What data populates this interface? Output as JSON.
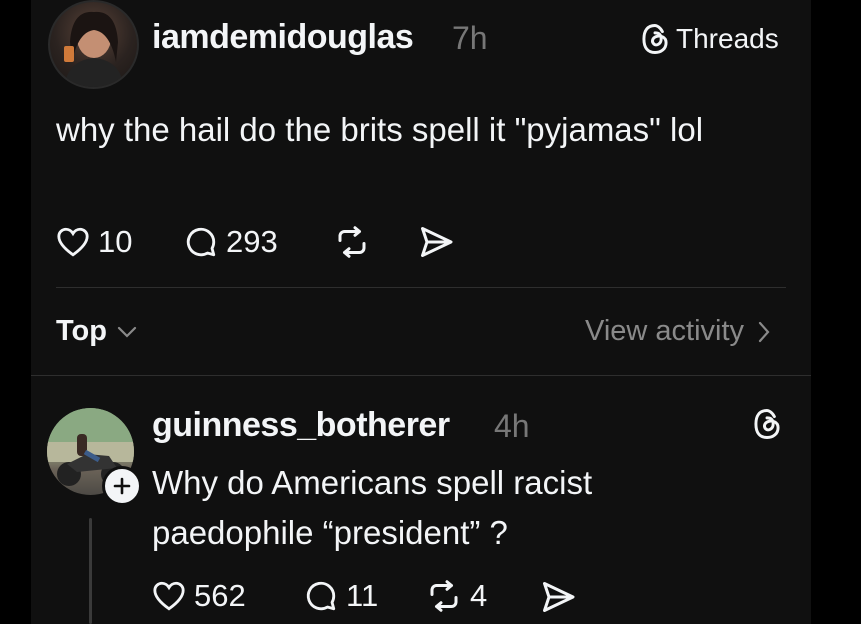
{
  "post": {
    "username": "iamdemidouglas",
    "time": "7h",
    "brand": "Threads",
    "text": "why the hail do the brits spell it \"pyjamas\" lol",
    "likes": "10",
    "replies": "293"
  },
  "sort": {
    "label": "Top",
    "view_activity": "View activity"
  },
  "reply": {
    "username": "guinness_botherer",
    "time": "4h",
    "text": "Why do Americans spell racist paedophile “president” ?",
    "likes": "562",
    "replies": "11",
    "reposts": "4"
  },
  "icons": [
    "heart-icon",
    "comment-icon",
    "repost-icon",
    "share-icon",
    "threads-logo-icon",
    "chevron-down-icon",
    "chevron-right-icon",
    "follow-plus-icon"
  ]
}
